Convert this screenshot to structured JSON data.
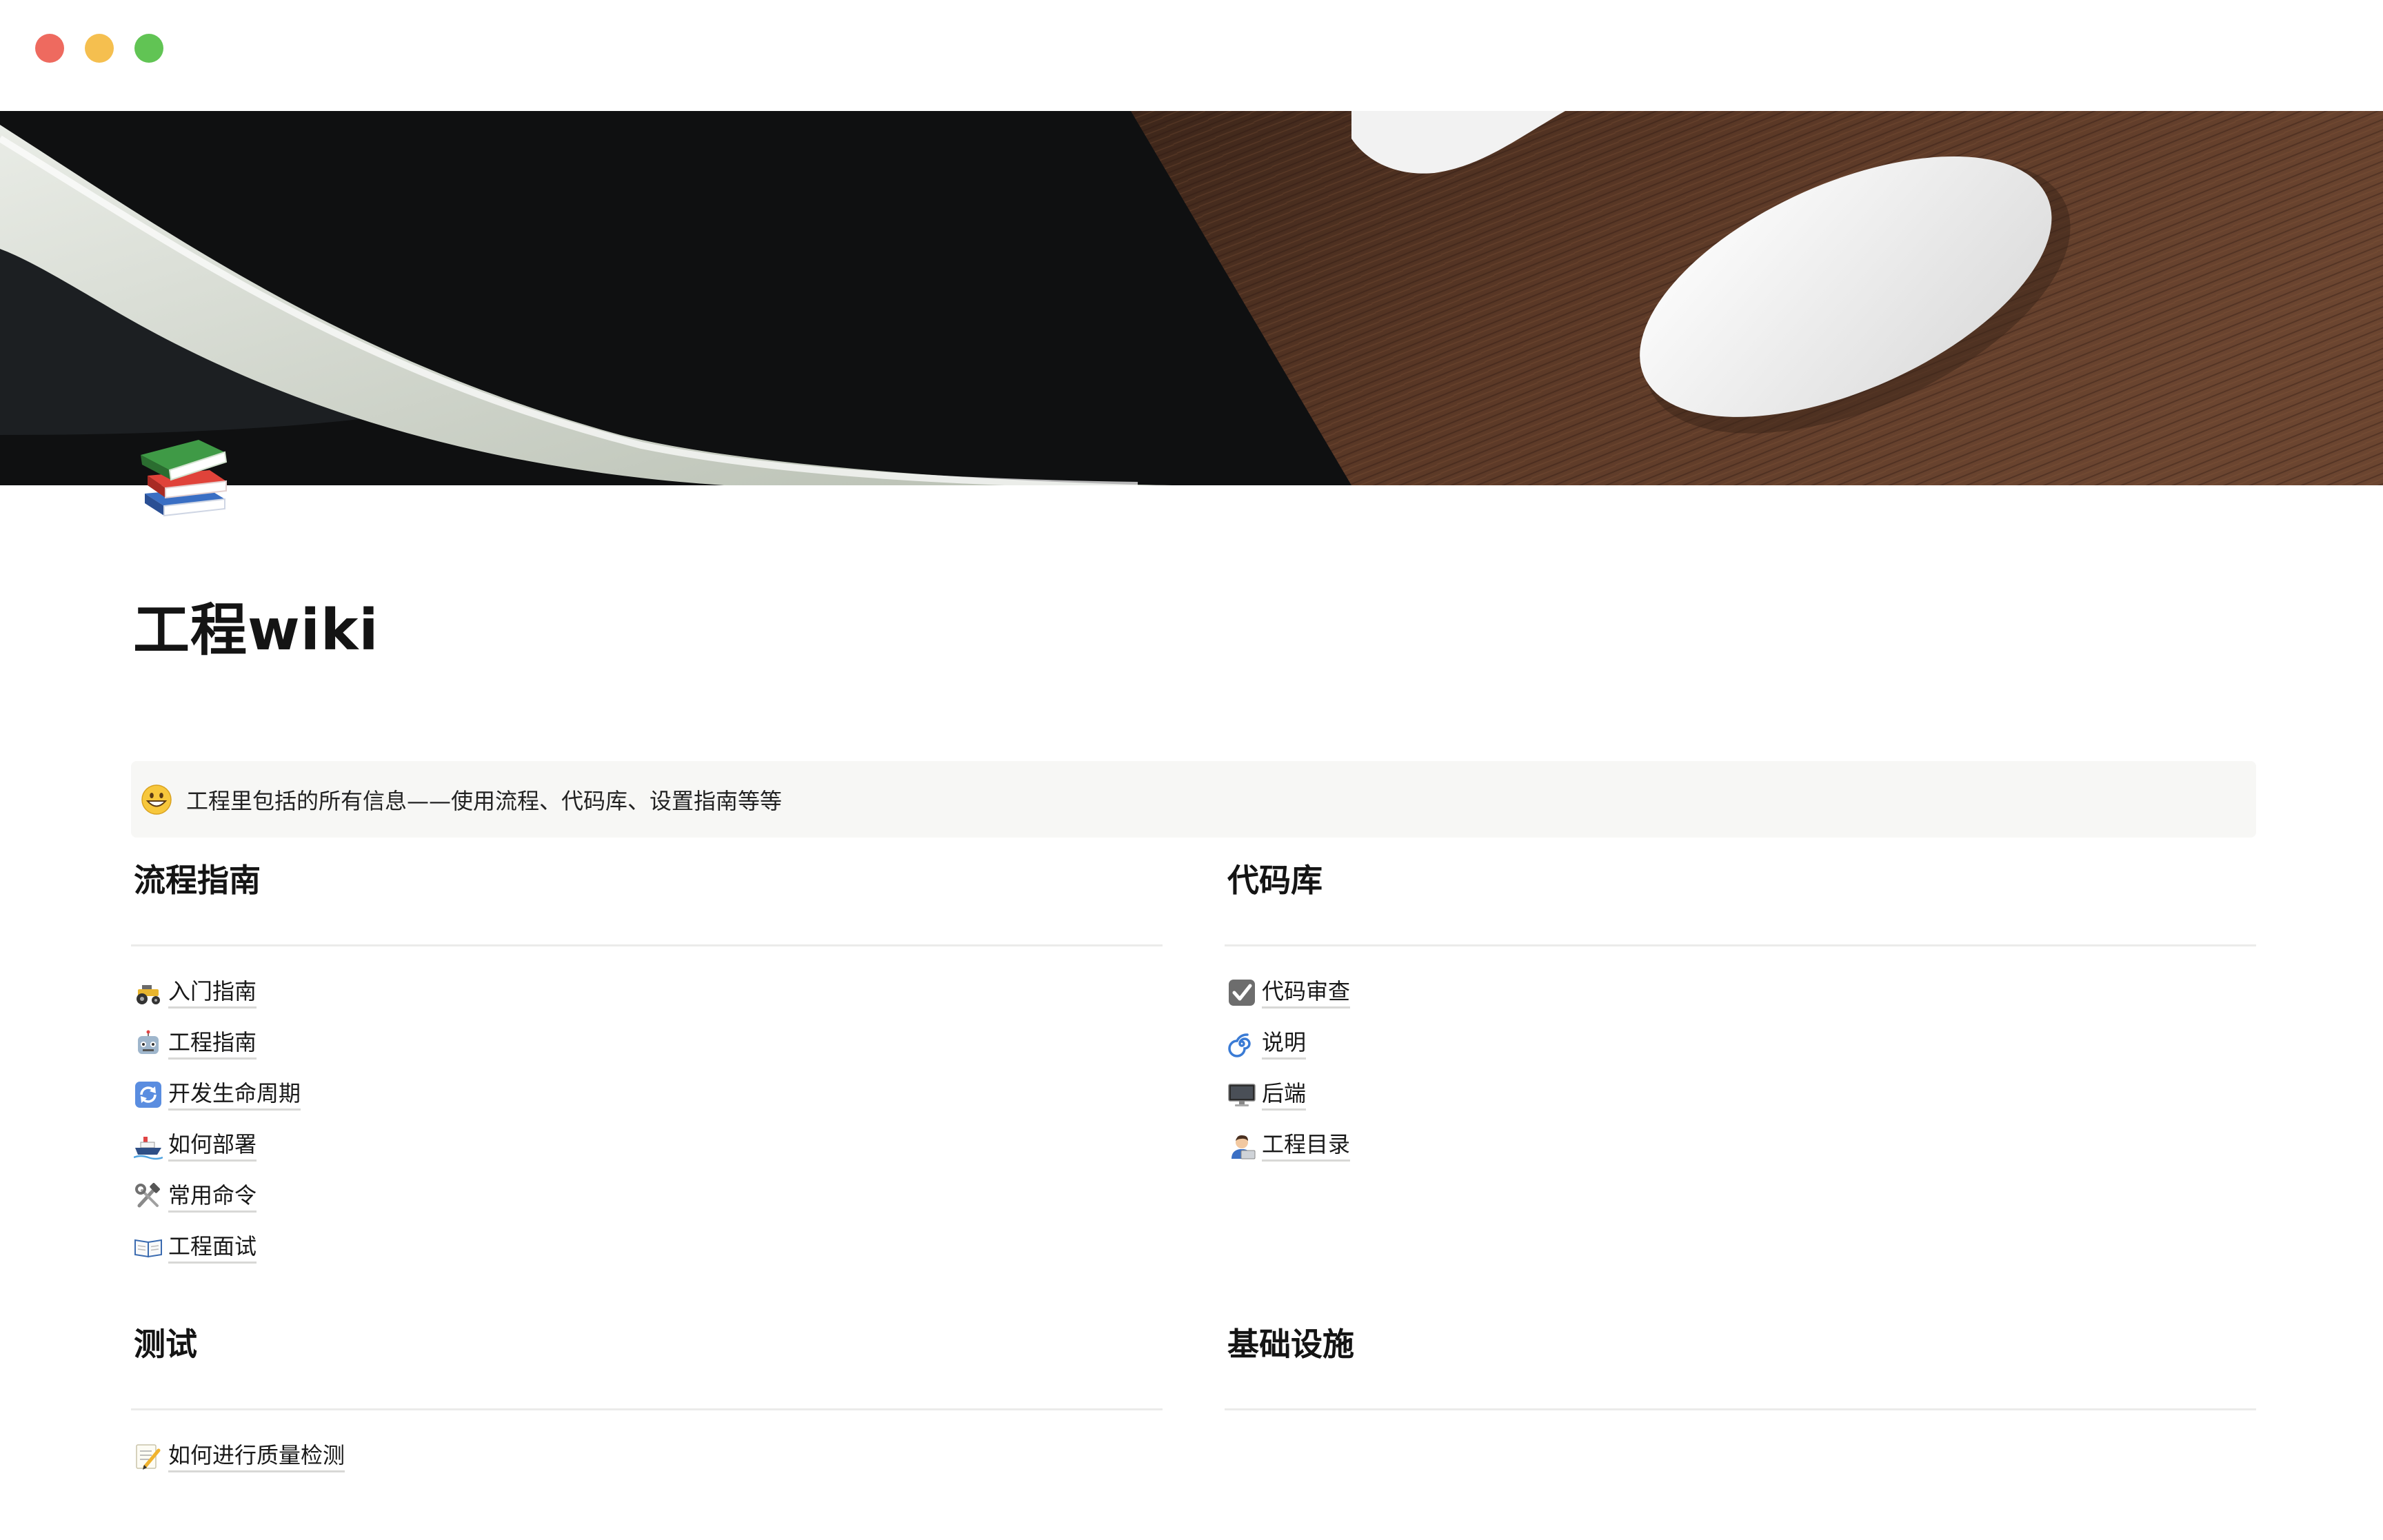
{
  "window": {
    "controls": [
      "close",
      "minimize",
      "zoom"
    ]
  },
  "page": {
    "icon": "books-emoji",
    "title": "工程wiki"
  },
  "callout": {
    "icon": "grinning-face-emoji",
    "text": "工程里包括的所有信息——使用流程、代码库、设置指南等等"
  },
  "sections": {
    "process": {
      "heading": "流程指南",
      "items": [
        {
          "icon": "tractor-emoji",
          "label": "入门指南"
        },
        {
          "icon": "robot-emoji",
          "label": "工程指南"
        },
        {
          "icon": "arrows-cycle-emoji",
          "label": "开发生命周期"
        },
        {
          "icon": "ship-emoji",
          "label": "如何部署"
        },
        {
          "icon": "hammer-wrench-emoji",
          "label": "常用命令"
        },
        {
          "icon": "open-book-emoji",
          "label": "工程面试"
        }
      ]
    },
    "codebase": {
      "heading": "代码库",
      "items": [
        {
          "icon": "check-box-emoji",
          "label": "代码审查"
        },
        {
          "icon": "cyclone-emoji",
          "label": "说明"
        },
        {
          "icon": "desktop-computer-emoji",
          "label": "后端"
        },
        {
          "icon": "technologist-emoji",
          "label": "工程目录"
        }
      ]
    },
    "testing": {
      "heading": "测试",
      "items": [
        {
          "icon": "memo-emoji",
          "label": "如何进行质量检测"
        }
      ]
    },
    "infrastructure": {
      "heading": "基础设施",
      "items": []
    }
  },
  "colors": {
    "close": "#ee6a5f",
    "minimize": "#f5bf4f",
    "zoom": "#61c454",
    "callout_bg": "#f7f7f5",
    "divider": "#ebebea"
  }
}
